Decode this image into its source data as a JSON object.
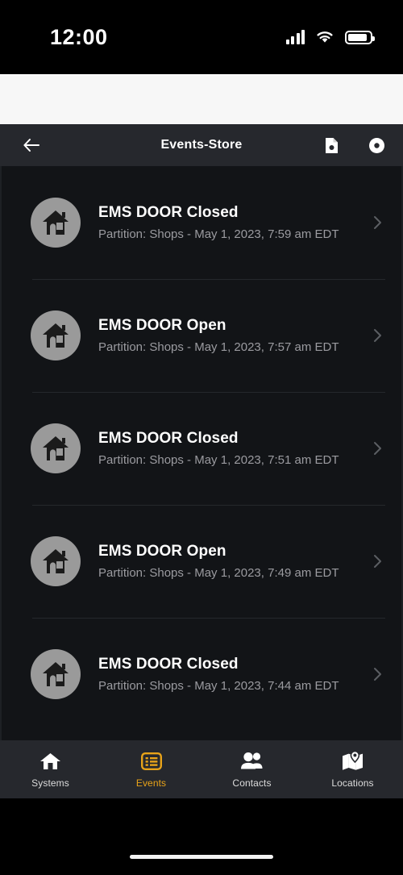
{
  "status_bar": {
    "time": "12:00",
    "cellular_icon": "cellular-signal-icon",
    "wifi_icon": "wifi-icon",
    "battery_icon": "battery-icon"
  },
  "nav_bar": {
    "title": "Events-Store",
    "back_icon": "arrow-left-icon",
    "document_icon": "document-icon",
    "add_icon": "add-circle-icon"
  },
  "events": [
    {
      "icon": "house-icon",
      "title": "EMS DOOR Closed",
      "subtitle": "Partition: Shops - May 1, 2023, 7:59 am EDT",
      "chevron": "chevron-right-icon"
    },
    {
      "icon": "house-icon",
      "title": "EMS DOOR Open",
      "subtitle": "Partition: Shops - May 1, 2023, 7:57 am EDT",
      "chevron": "chevron-right-icon"
    },
    {
      "icon": "house-icon",
      "title": "EMS DOOR Closed",
      "subtitle": "Partition: Shops - May 1, 2023, 7:51 am EDT",
      "chevron": "chevron-right-icon"
    },
    {
      "icon": "house-icon",
      "title": "EMS DOOR Open",
      "subtitle": "Partition: Shops - May 1, 2023, 7:49 am EDT",
      "chevron": "chevron-right-icon"
    },
    {
      "icon": "house-icon",
      "title": "EMS DOOR Closed",
      "subtitle": "Partition: Shops - May 1, 2023, 7:44 am EDT",
      "chevron": "chevron-right-icon"
    }
  ],
  "tabs": [
    {
      "label": "Systems",
      "icon": "home-icon",
      "active": false
    },
    {
      "label": "Events",
      "icon": "list-icon",
      "active": true
    },
    {
      "label": "Contacts",
      "icon": "people-icon",
      "active": false
    },
    {
      "label": "Locations",
      "icon": "map-pin-icon",
      "active": false
    }
  ],
  "colors": {
    "accent": "#e8a319",
    "nav_background": "#26282d",
    "list_background": "#121417",
    "title_text": "#ffffff",
    "subtitle_text": "#9b9ba0",
    "avatar_circle": "#9a9a9a"
  }
}
